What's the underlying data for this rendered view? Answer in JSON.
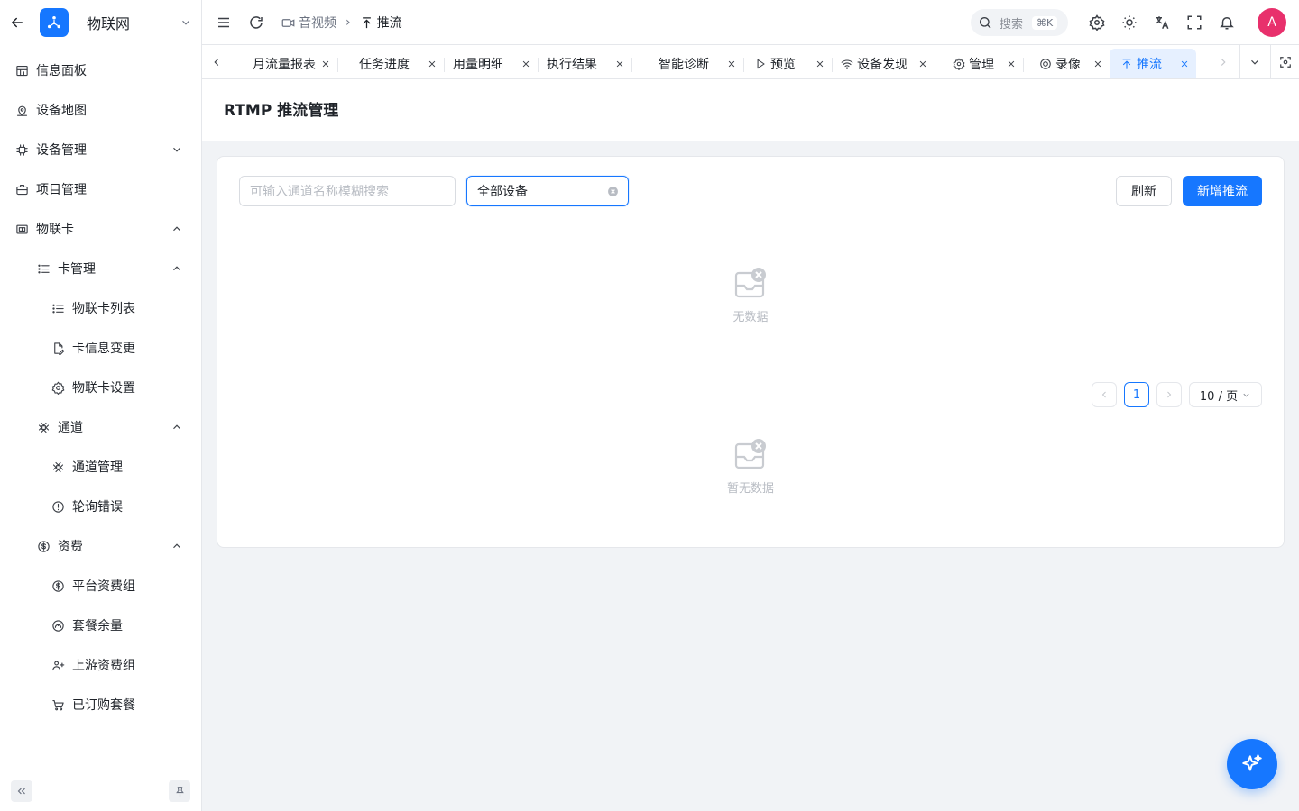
{
  "sidebar": {
    "app_title": "物联网",
    "items": [
      {
        "label": "信息面板",
        "icon": "dashboard-icon"
      },
      {
        "label": "设备地图",
        "icon": "map-pin-icon"
      },
      {
        "label": "设备管理",
        "icon": "cpu-icon",
        "expanded": false
      },
      {
        "label": "项目管理",
        "icon": "briefcase-icon"
      },
      {
        "label": "物联卡",
        "icon": "sim-card-icon",
        "expanded": true
      },
      {
        "label": "卡管理",
        "icon": "list-icon",
        "expanded": true
      },
      {
        "label": "物联卡列表",
        "icon": "list-icon"
      },
      {
        "label": "卡信息变更",
        "icon": "file-edit-icon"
      },
      {
        "label": "物联卡设置",
        "icon": "gear-icon"
      },
      {
        "label": "通道",
        "icon": "channel-icon",
        "expanded": true
      },
      {
        "label": "通道管理",
        "icon": "channel-icon"
      },
      {
        "label": "轮询错误",
        "icon": "alert-circle-icon"
      },
      {
        "label": "资费",
        "icon": "dollar-circle-icon",
        "expanded": true
      },
      {
        "label": "平台资费组",
        "icon": "dollar-circle-icon"
      },
      {
        "label": "套餐余量",
        "icon": "gauge-icon"
      },
      {
        "label": "上游资费组",
        "icon": "users-icon"
      },
      {
        "label": "已订购套餐",
        "icon": "cart-icon"
      }
    ]
  },
  "header": {
    "breadcrumb": [
      "音视频",
      "推流"
    ],
    "search_placeholder": "搜索",
    "search_shortcut": "⌘K",
    "avatar_initial": "A"
  },
  "tabs": [
    {
      "label": "月流量报表",
      "active": false
    },
    {
      "label": "任务进度",
      "active": false
    },
    {
      "label": "用量明细",
      "active": false
    },
    {
      "label": "执行结果",
      "active": false
    },
    {
      "label": "智能诊断",
      "active": false
    },
    {
      "label": "预览",
      "icon": "play-icon",
      "active": false
    },
    {
      "label": "设备发现",
      "icon": "wifi-icon",
      "active": false
    },
    {
      "label": "管理",
      "icon": "gear-icon",
      "active": false
    },
    {
      "label": "录像",
      "icon": "record-icon",
      "active": false
    },
    {
      "label": "推流",
      "icon": "upload-icon",
      "active": true
    }
  ],
  "page": {
    "title": "RTMP 推流管理",
    "search_placeholder": "可输入通道名称模糊搜索",
    "device_select_value": "全部设备",
    "refresh_label": "刷新",
    "add_label": "新增推流",
    "empty_text_1": "无数据",
    "empty_text_2": "暂无数据",
    "pagination": {
      "current_page": "1",
      "page_size": "10 / 页"
    }
  },
  "colors": {
    "primary": "#1677ff",
    "avatar": "#e8306c"
  }
}
